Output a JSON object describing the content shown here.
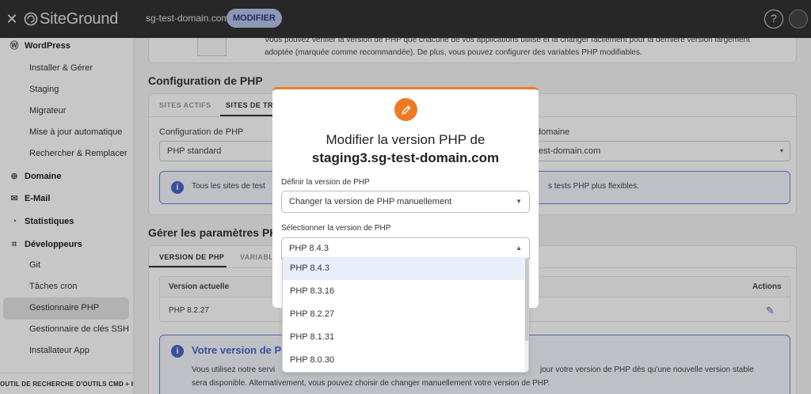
{
  "topbar": {
    "close_icon": "close-icon",
    "logo_text": "SiteGround",
    "domain": "sg-test-domain.com",
    "modify_badge": "MODIFIER",
    "help_icon": "?"
  },
  "sidebar": {
    "wordpress": {
      "label": "WordPress",
      "items": [
        "Installer & Gérer",
        "Staging",
        "Migrateur",
        "Mise à jour automatique",
        "Rechercher & Remplacer"
      ]
    },
    "domaine": "Domaine",
    "email": "E-Mail",
    "statistiques": "Statistiques",
    "developpeurs": {
      "label": "Développeurs",
      "items": [
        "Git",
        "Tâches cron",
        "Gestionnaire PHP",
        "Gestionnaire de clés SSH",
        "Installateur App"
      ]
    },
    "tool_search": "OUTIL DE RECHERCHE D'OUTILS CMD + K"
  },
  "main": {
    "intro_text_1": "Vous pouvez vérifier la version de PHP que chacune de vos applications utilise et la changer facilement pour la dernière version largement",
    "intro_text_2": "adoptée (marquée comme recommandée). De plus, vous pouvez configurer des variables PHP modifiables.",
    "config_title": "Configuration de PHP",
    "tab_active_sites": "SITES ACTIFS",
    "tab_staging_sites": "SITES DE TRA",
    "config_label": "Configuration de PHP",
    "config_value": "PHP standard",
    "domain_label": "domaine",
    "domain_value": "test-domain.com",
    "info_text_left": "Tous les sites de test",
    "info_text_right": "s tests PHP plus flexibles.",
    "manage_title": "Gérer les paramètres PH",
    "tab_php_version": "VERSION DE PHP",
    "tab_variables": "VARIABL",
    "col_current": "Version actuelle",
    "col_actions": "Actions",
    "current_version": "PHP 8.2.27",
    "your_version_title": "Votre version de PHP",
    "your_version_text_1_left": "Vous utilisez notre servi",
    "your_version_text_1_right": "jour votre version de PHP dès qu'une nouvelle version stable",
    "your_version_text_2": "sera disponible. Alternativement, vous pouvez choisir de changer manuellement votre version de PHP."
  },
  "modal": {
    "title_line1": "Modifier la version PHP de",
    "title_line2": "staging3.sg-test-domain.com",
    "define_label": "Définir la version de PHP",
    "define_value": "Changer la version de PHP manuellement",
    "select_label": "Sélectionner la version de PHP",
    "select_value": "PHP 8.4.3",
    "options": [
      "PHP 8.4.3",
      "PHP 8.3.16",
      "PHP 8.2.27",
      "PHP 8.1.31",
      "PHP 8.0.30"
    ]
  },
  "colors": {
    "accent_orange": "#ee7c28",
    "info_blue": "#4a66c8",
    "topbar_bg": "#333333"
  }
}
